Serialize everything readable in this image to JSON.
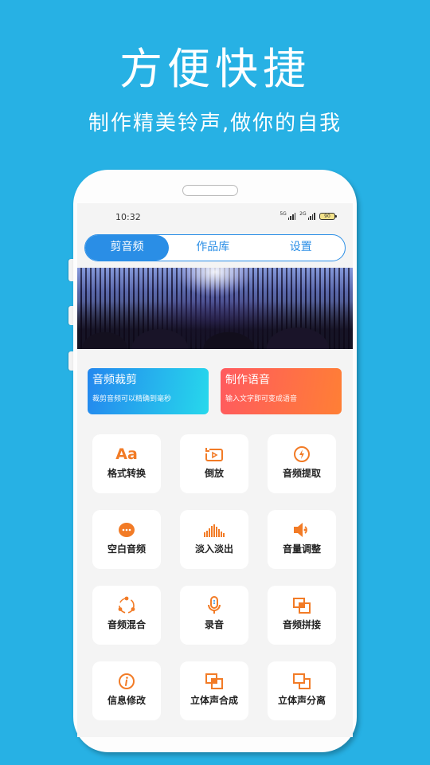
{
  "promo": {
    "headline": "方便快捷",
    "subline": "制作精美铃声,做你的自我"
  },
  "status_bar": {
    "time": "10:32",
    "signal1_label": "5G",
    "signal2_label": "2G",
    "battery": "90"
  },
  "tabs": [
    {
      "label": "剪音频",
      "active": true
    },
    {
      "label": "作品库",
      "active": false
    },
    {
      "label": "设置",
      "active": false
    }
  ],
  "banner": {
    "icon": "concert-crowd-image"
  },
  "feature_cards": [
    {
      "title": "音频裁剪",
      "desc": "裁剪音频可以精确到毫秒",
      "color_start": "#2487ee",
      "color_end": "#27d8ec"
    },
    {
      "title": "制作语音",
      "desc": "输入文字即可变成语音",
      "color_start": "#ff5a5f",
      "color_end": "#ff7f35"
    }
  ],
  "tools": [
    {
      "label": "格式转换",
      "icon": "format-convert-icon"
    },
    {
      "label": "倒放",
      "icon": "reverse-play-icon"
    },
    {
      "label": "音频提取",
      "icon": "extract-lightning-icon"
    },
    {
      "label": "空白音频",
      "icon": "blank-audio-icon"
    },
    {
      "label": "淡入淡出",
      "icon": "fade-bars-icon"
    },
    {
      "label": "音量调整",
      "icon": "volume-icon"
    },
    {
      "label": "音频混合",
      "icon": "mix-circle-icon"
    },
    {
      "label": "录音",
      "icon": "microphone-icon"
    },
    {
      "label": "音频拼接",
      "icon": "splice-squares-icon"
    },
    {
      "label": "信息修改",
      "icon": "info-icon"
    },
    {
      "label": "立体声合成",
      "icon": "stereo-merge-icon"
    },
    {
      "label": "立体声分离",
      "icon": "stereo-split-icon"
    }
  ],
  "colors": {
    "background": "#27b1e4",
    "accent_blue": "#2a8ee6",
    "accent_orange": "#f27b26"
  }
}
